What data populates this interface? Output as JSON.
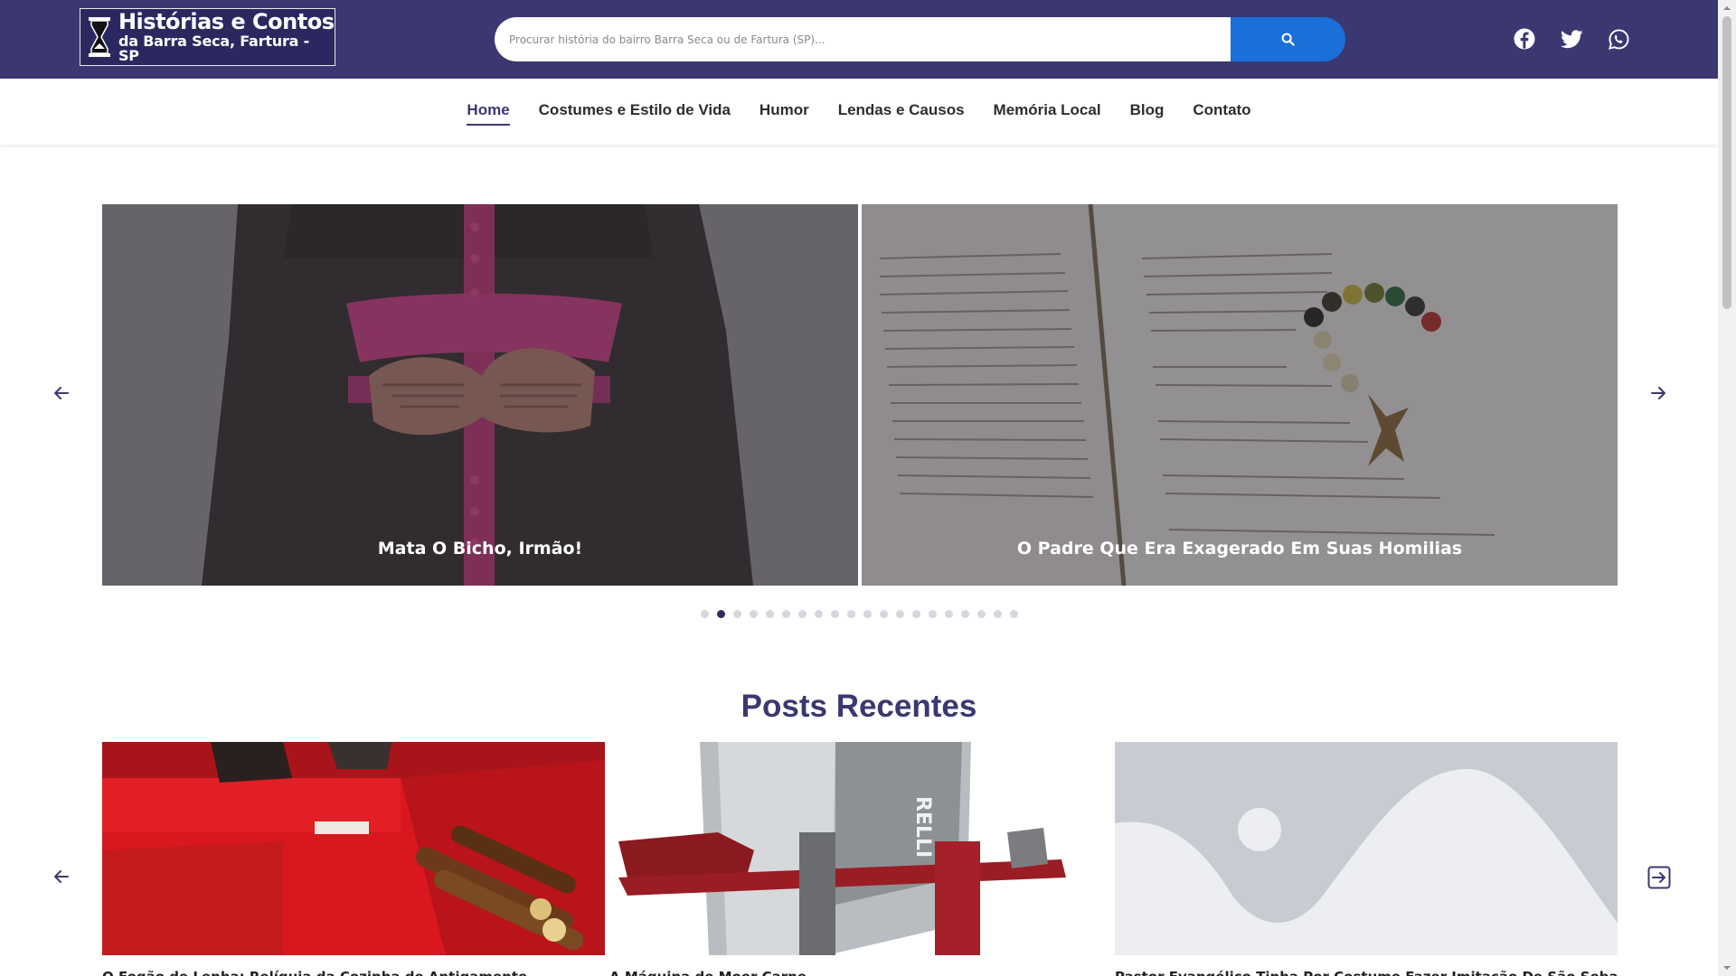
{
  "header": {
    "logo_line1": "Histórias e Contos",
    "logo_line2": "da Barra Seca, Fartura - SP",
    "search_placeholder": "Procurar história do bairro Barra Seca ou de Fartura (SP)...",
    "social": [
      "facebook-icon",
      "twitter-icon",
      "whatsapp-icon"
    ]
  },
  "nav": {
    "items": [
      {
        "label": "Home",
        "active": true
      },
      {
        "label": "Costumes e Estilo de Vida"
      },
      {
        "label": "Humor"
      },
      {
        "label": "Lendas e Causos"
      },
      {
        "label": "Memória Local"
      },
      {
        "label": "Blog"
      },
      {
        "label": "Contato"
      }
    ]
  },
  "slider": {
    "slides": [
      {
        "caption": "Mata O Bicho, Irmão!"
      },
      {
        "caption": "O Padre Que Era Exagerado Em Suas Homilias"
      }
    ],
    "dot_count": 20,
    "active_dot": 1
  },
  "recent": {
    "title": "Posts Recentes",
    "posts": [
      {
        "title": "O Fogão de Lenha: Relíquia da Cozinha de Antigamente"
      },
      {
        "title": "A Máquina de Moer Carne"
      },
      {
        "title": "Pastor Evangélico Tinha Por Costume Fazer Imitação De São Sebastião"
      }
    ]
  },
  "colors": {
    "brand": "#3b3871",
    "search_button": "#1b6fd9"
  }
}
